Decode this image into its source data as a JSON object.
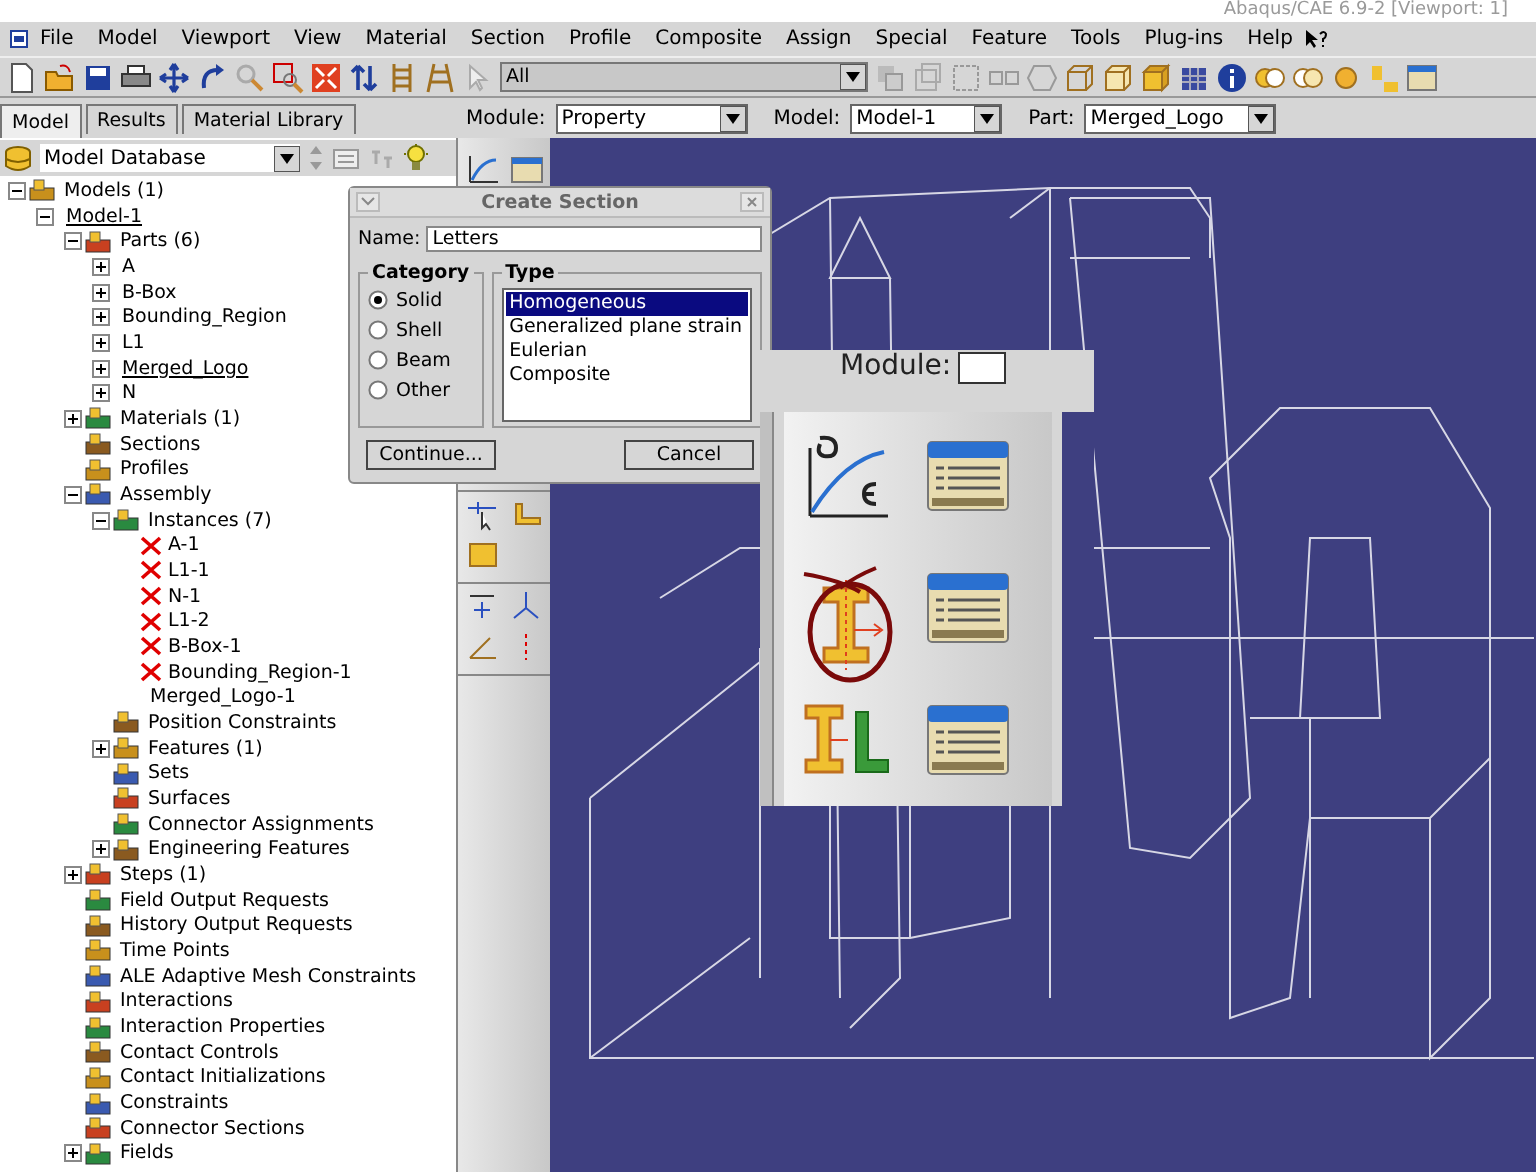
{
  "window": {
    "title": "Abaqus/CAE 6.9-2 [Viewport: 1]"
  },
  "menu": [
    "File",
    "Model",
    "Viewport",
    "View",
    "Material",
    "Section",
    "Profile",
    "Composite",
    "Assign",
    "Special",
    "Feature",
    "Tools",
    "Plug-ins",
    "Help"
  ],
  "toolbar": {
    "selection_filter": "All"
  },
  "panel_tabs": [
    {
      "label": "Model",
      "selected": true
    },
    {
      "label": "Results",
      "selected": false
    },
    {
      "label": "Material Library",
      "selected": false
    }
  ],
  "context": {
    "module_label": "Module:",
    "module": "Property",
    "model_label": "Model:",
    "model": "Model-1",
    "part_label": "Part:",
    "part": "Merged_Logo"
  },
  "database": {
    "value": "Model Database"
  },
  "tree": {
    "items": [
      {
        "label": "Models (1)",
        "kind": "icon",
        "expanded": true,
        "current": false,
        "children": [
          {
            "label": "Model-1",
            "kind": "plain",
            "expanded": true,
            "current": true,
            "children": [
              {
                "label": "Parts (6)",
                "kind": "icon",
                "expanded": true,
                "current": false,
                "children": [
                  {
                    "label": "A",
                    "kind": "plain",
                    "expanded": false,
                    "current": false
                  },
                  {
                    "label": "B-Box",
                    "kind": "plain",
                    "expanded": false,
                    "current": false
                  },
                  {
                    "label": "Bounding_Region",
                    "kind": "plain",
                    "expanded": false,
                    "current": false
                  },
                  {
                    "label": "L1",
                    "kind": "plain",
                    "expanded": false,
                    "current": false
                  },
                  {
                    "label": "Merged_Logo",
                    "kind": "plain",
                    "expanded": false,
                    "current": true
                  },
                  {
                    "label": "N",
                    "kind": "plain",
                    "expanded": false,
                    "current": false
                  }
                ]
              },
              {
                "label": "Materials (1)",
                "kind": "icon",
                "expanded": false,
                "current": false
              },
              {
                "label": "Sections",
                "kind": "icon",
                "current": false
              },
              {
                "label": "Profiles",
                "kind": "icon",
                "current": false
              },
              {
                "label": "Assembly",
                "kind": "icon",
                "expanded": true,
                "current": false,
                "children": [
                  {
                    "label": "Instances (7)",
                    "kind": "icon",
                    "expanded": true,
                    "current": false,
                    "children": [
                      {
                        "label": "A-1",
                        "kind": "flagged",
                        "current": false
                      },
                      {
                        "label": "L1-1",
                        "kind": "flagged",
                        "current": false
                      },
                      {
                        "label": "N-1",
                        "kind": "flagged",
                        "current": false
                      },
                      {
                        "label": "L1-2",
                        "kind": "flagged",
                        "current": false
                      },
                      {
                        "label": "B-Box-1",
                        "kind": "flagged",
                        "current": false
                      },
                      {
                        "label": "Bounding_Region-1",
                        "kind": "flagged",
                        "current": false
                      },
                      {
                        "label": "Merged_Logo-1",
                        "kind": "plain",
                        "current": false
                      }
                    ]
                  },
                  {
                    "label": "Position Constraints",
                    "kind": "icon",
                    "current": false
                  },
                  {
                    "label": "Features (1)",
                    "kind": "icon",
                    "expanded": false,
                    "current": false
                  },
                  {
                    "label": "Sets",
                    "kind": "icon",
                    "current": false
                  },
                  {
                    "label": "Surfaces",
                    "kind": "icon",
                    "current": false
                  },
                  {
                    "label": "Connector Assignments",
                    "kind": "icon",
                    "current": false
                  },
                  {
                    "label": "Engineering Features",
                    "kind": "icon",
                    "expanded": false,
                    "current": false
                  }
                ]
              },
              {
                "label": "Steps (1)",
                "kind": "icon",
                "expanded": false,
                "current": false
              },
              {
                "label": "Field Output Requests",
                "kind": "icon",
                "current": false
              },
              {
                "label": "History Output Requests",
                "kind": "icon",
                "current": false
              },
              {
                "label": "Time Points",
                "kind": "icon",
                "current": false
              },
              {
                "label": "ALE Adaptive Mesh Constraints",
                "kind": "icon",
                "current": false
              },
              {
                "label": "Interactions",
                "kind": "icon",
                "current": false
              },
              {
                "label": "Interaction Properties",
                "kind": "icon",
                "current": false
              },
              {
                "label": "Contact Controls",
                "kind": "icon",
                "current": false
              },
              {
                "label": "Contact Initializations",
                "kind": "icon",
                "current": false
              },
              {
                "label": "Constraints",
                "kind": "icon",
                "current": false
              },
              {
                "label": "Connector Sections",
                "kind": "icon",
                "current": false
              },
              {
                "label": "Fields",
                "kind": "icon",
                "expanded": false,
                "current": false
              }
            ]
          }
        ]
      }
    ]
  },
  "dialog": {
    "title": "Create Section",
    "name_label": "Name:",
    "name": "Letters",
    "category_title": "Category",
    "categories": [
      {
        "label": "Solid",
        "selected": true
      },
      {
        "label": "Shell",
        "selected": false
      },
      {
        "label": "Beam",
        "selected": false
      },
      {
        "label": "Other",
        "selected": false
      }
    ],
    "type_title": "Type",
    "types": [
      {
        "label": "Homogeneous",
        "selected": true
      },
      {
        "label": "Generalized plane strain",
        "selected": false
      },
      {
        "label": "Eulerian",
        "selected": false
      },
      {
        "label": "Composite",
        "selected": false
      }
    ],
    "buttons": [
      "Continue...",
      "Cancel"
    ]
  },
  "inset": {
    "module_label": "Module:"
  }
}
